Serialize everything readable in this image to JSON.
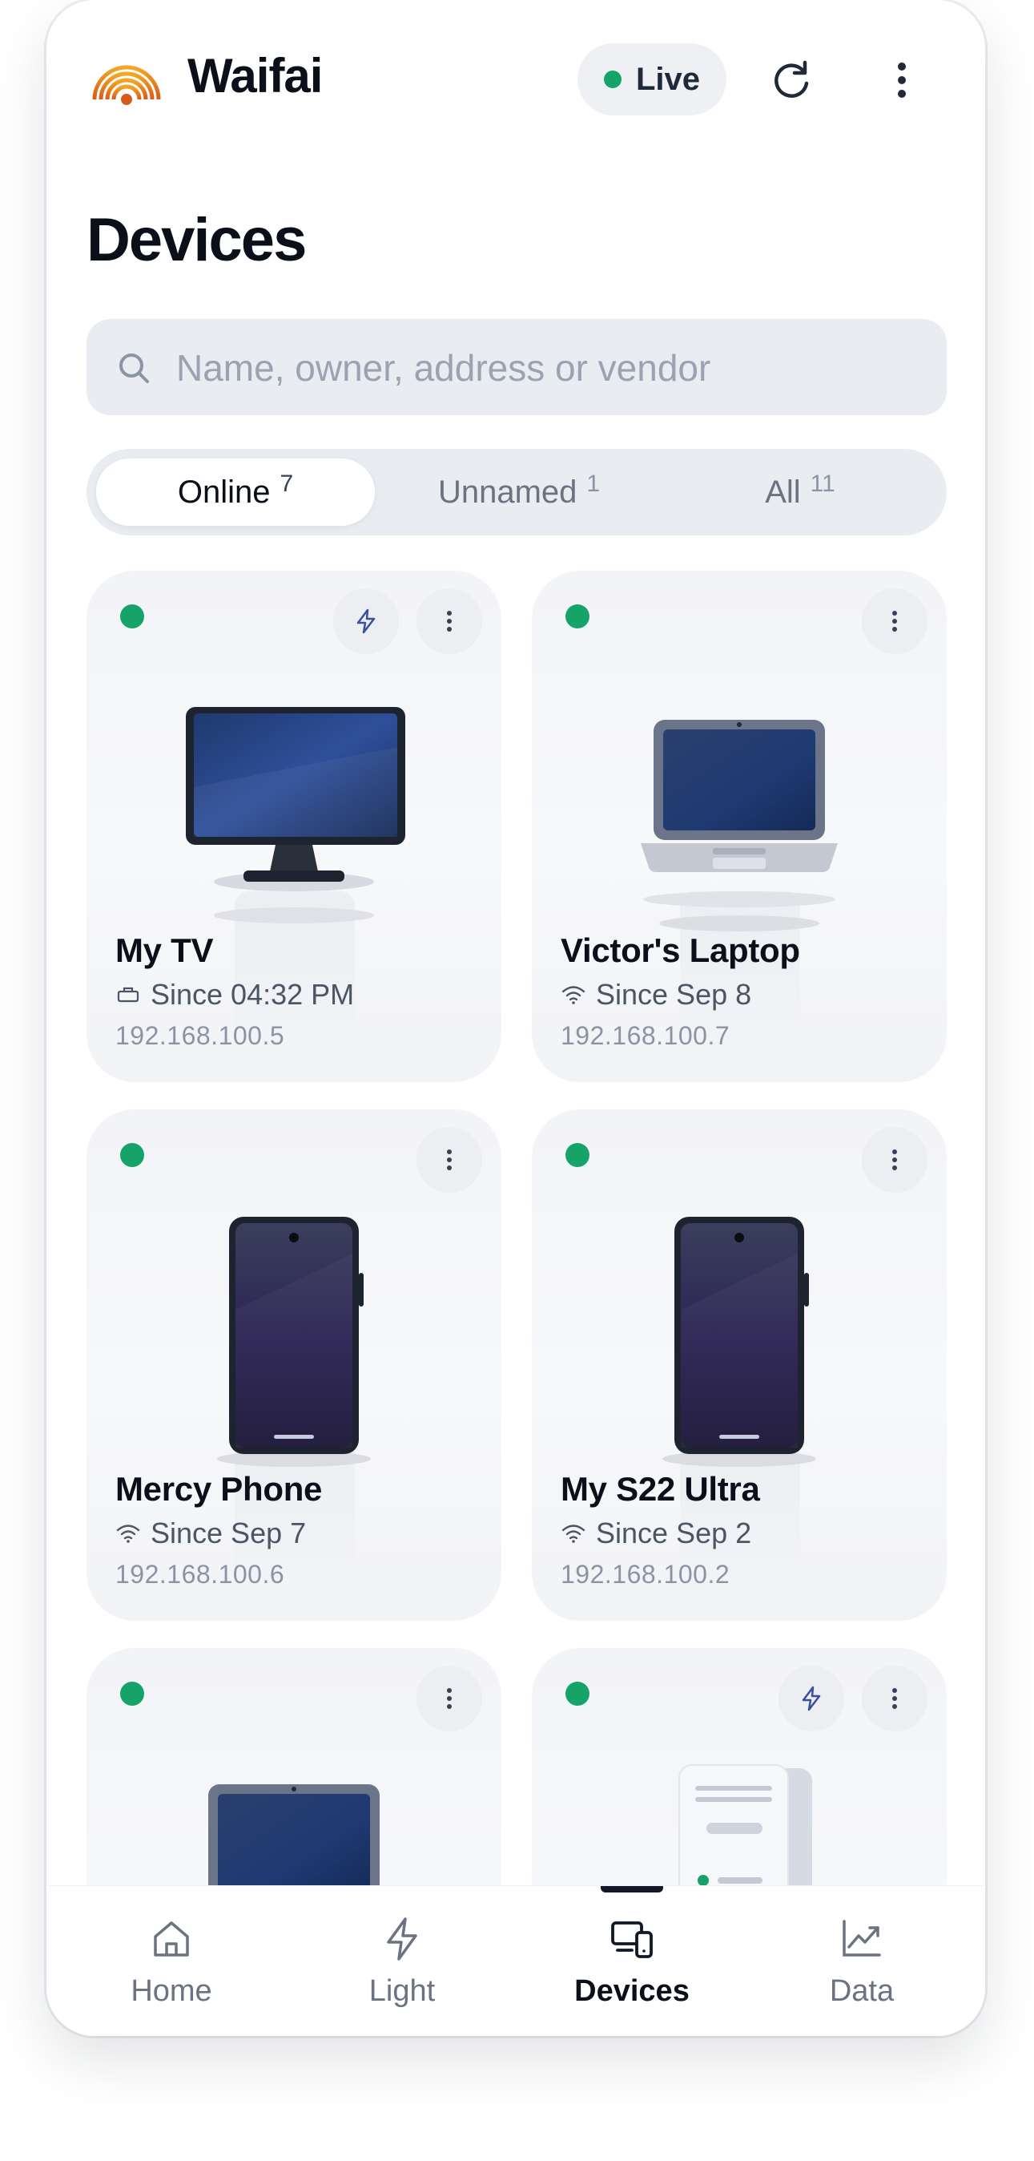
{
  "app": {
    "name": "Waifai",
    "status_label": "Live",
    "status_color": "#16a36a",
    "accent_color": "#e0741e"
  },
  "header": {
    "refresh_icon": "refresh-icon",
    "more_icon": "more-vertical-icon"
  },
  "page": {
    "title": "Devices"
  },
  "search": {
    "placeholder": "Name, owner, address or vendor",
    "value": ""
  },
  "filters": [
    {
      "label": "Online",
      "count": "7",
      "active": true
    },
    {
      "label": "Unnamed",
      "count": "1",
      "active": false
    },
    {
      "label": "All",
      "count": "11",
      "active": false
    }
  ],
  "devices": [
    {
      "name": "My TV",
      "since": "Since 04:32 PM",
      "ip": "192.168.100.5",
      "connection": "ethernet-icon",
      "type": "tv",
      "online": true,
      "power_button": true
    },
    {
      "name": "Victor's Laptop",
      "since": "Since Sep 8",
      "ip": "192.168.100.7",
      "connection": "wifi-icon",
      "type": "laptop",
      "online": true,
      "power_button": false
    },
    {
      "name": "Mercy Phone",
      "since": "Since Sep 7",
      "ip": "192.168.100.6",
      "connection": "wifi-icon",
      "type": "phone",
      "online": true,
      "power_button": false
    },
    {
      "name": "My S22 Ultra",
      "since": "Since Sep 2",
      "ip": "192.168.100.2",
      "connection": "wifi-icon",
      "type": "phone",
      "online": true,
      "power_button": false
    },
    {
      "name": "",
      "since": "",
      "ip": "",
      "connection": "",
      "type": "laptop",
      "online": true,
      "power_button": false
    },
    {
      "name": "",
      "since": "",
      "ip": "",
      "connection": "",
      "type": "server",
      "online": true,
      "power_button": true
    }
  ],
  "nav": [
    {
      "label": "Home",
      "icon": "home-icon",
      "active": false
    },
    {
      "label": "Light",
      "icon": "bolt-icon",
      "active": false
    },
    {
      "label": "Devices",
      "icon": "devices-icon",
      "active": true
    },
    {
      "label": "Data",
      "icon": "trend-icon",
      "active": false
    }
  ]
}
